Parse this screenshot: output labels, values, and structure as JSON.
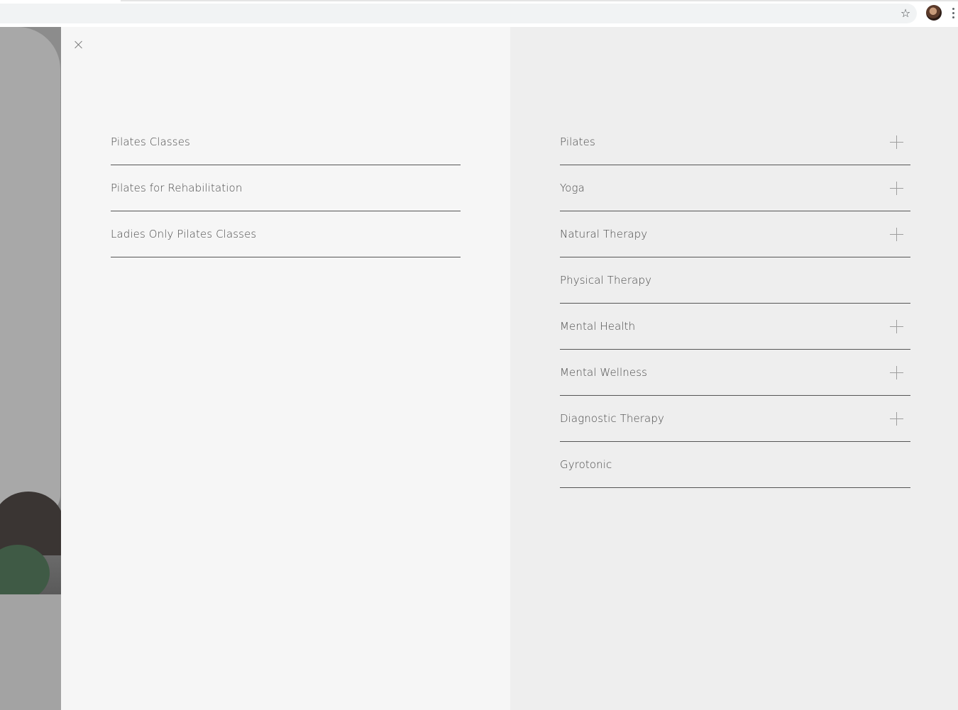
{
  "browser": {
    "bookmark_icon": "star-icon",
    "profile_icon": "avatar",
    "menu_icon": "kebab-icon"
  },
  "menu": {
    "close_icon": "close-icon",
    "left_items": [
      {
        "label": "Pilates Classes"
      },
      {
        "label": "Pilates for Rehabilitation"
      },
      {
        "label": "Ladies Only Pilates Classes"
      }
    ],
    "right_items": [
      {
        "label": "Pilates",
        "expandable": true
      },
      {
        "label": "Yoga",
        "expandable": true
      },
      {
        "label": "Natural Therapy",
        "expandable": true
      },
      {
        "label": "Physical Therapy",
        "expandable": false
      },
      {
        "label": "Mental Health",
        "expandable": true
      },
      {
        "label": "Mental Wellness",
        "expandable": true
      },
      {
        "label": "Diagnostic Therapy",
        "expandable": true
      },
      {
        "label": "Gyrotonic",
        "expandable": false
      }
    ]
  },
  "colors": {
    "left_panel_bg": "#f6f6f6",
    "right_panel_bg": "#eeeeee",
    "divider": "#555555",
    "text": "#4a4a4a",
    "overlay_dim": "#9a9a9a"
  }
}
